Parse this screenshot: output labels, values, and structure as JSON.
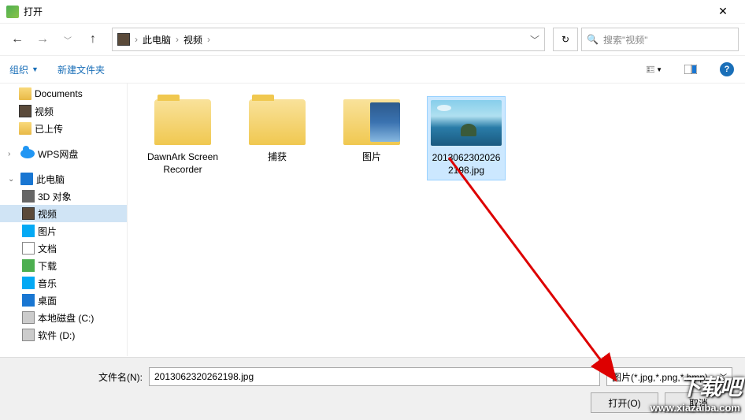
{
  "window": {
    "title": "打开"
  },
  "breadcrumb": {
    "root": "此电脑",
    "folder": "视频"
  },
  "search": {
    "placeholder": "搜索\"视频\""
  },
  "toolbar": {
    "organize": "组织",
    "new_folder": "新建文件夹"
  },
  "tree": {
    "documents": "Documents",
    "video": "视频",
    "uploaded": "已上传",
    "wps": "WPS网盘",
    "pc": "此电脑",
    "obj3d": "3D 对象",
    "video2": "视频",
    "pictures": "图片",
    "docs": "文档",
    "downloads": "下载",
    "music": "音乐",
    "desktop": "桌面",
    "disk_c": "本地磁盘 (C:)",
    "disk_d": "软件 (D:)"
  },
  "items": {
    "folders": [
      "DawnArk Screen Recorder",
      "捕获",
      "图片"
    ],
    "file": "20130623020262198.jpg"
  },
  "bottom": {
    "filename_label": "文件名(N):",
    "filename_value": "2013062320262198.jpg",
    "filter": "图片(*.jpg,*.png,*.bmp)",
    "open_btn": "打开(O)",
    "cancel_btn": "取消"
  },
  "watermark": {
    "big": "下载吧",
    "url": "www.xiazaiba.com"
  }
}
